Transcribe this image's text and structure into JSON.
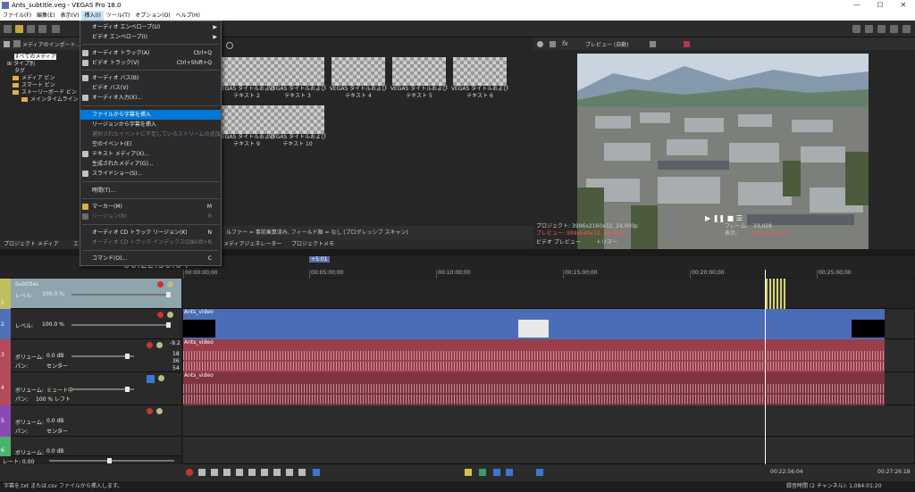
{
  "window": {
    "title": "Ants_subtitle.veg - VEGAS Pro 18.0",
    "minimize": "—",
    "maximize": "☐",
    "close": "✕"
  },
  "menu": [
    "ファイル(F)",
    "編集(E)",
    "表示(V)",
    "挿入(I)",
    "ツール(T)",
    "オプション(O)",
    "ヘルプ(H)"
  ],
  "insert_menu": [
    {
      "label": "オーディオ エンベロープ(U)",
      "shortcut": "",
      "submenu": true
    },
    {
      "label": "ビデオ エンベロープ(I)",
      "shortcut": "",
      "submenu": true
    },
    {
      "label": "オーディオ トラック(A)",
      "shortcut": "Ctrl+Q"
    },
    {
      "label": "ビデオ トラック(V)",
      "shortcut": "Ctrl+Shift+Q"
    },
    {
      "label": "オーディオ バス(B)",
      "shortcut": ""
    },
    {
      "label": "ビデオ バス(V)",
      "shortcut": ""
    },
    {
      "label": "オーディオ入力(X)...",
      "shortcut": ""
    },
    {
      "label": "ファイルから字幕を挿入",
      "shortcut": ""
    },
    {
      "label": "リージョンから字幕を挿入",
      "shortcut": ""
    },
    {
      "label": "選択されたイベントに不足しているストリームの追加",
      "shortcut": ""
    },
    {
      "label": "空のイベント(E)",
      "shortcut": ""
    },
    {
      "label": "テキスト メディア(X)...",
      "shortcut": ""
    },
    {
      "label": "生成されたメディア(G)...",
      "shortcut": ""
    },
    {
      "label": "スライドショー(S)...",
      "shortcut": ""
    },
    {
      "label": "時間(T)...",
      "shortcut": ""
    },
    {
      "label": "マーカー(M)",
      "shortcut": "M"
    },
    {
      "label": "リージョン(R)",
      "shortcut": "R"
    },
    {
      "label": "オーディオ CD トラック リージョン(K)",
      "shortcut": "N"
    },
    {
      "label": "オーディオ CD トラック インデックス(D)",
      "shortcut": "Shift+N"
    },
    {
      "label": "コマンド(O)...",
      "shortcut": "C"
    }
  ],
  "media_panel": {
    "header": "メディアのインポート...",
    "tree": [
      "すべてのメディア",
      "タイプ別",
      "タグ",
      "メディア ビン",
      "スマート ビン",
      "ストーリーボード ビン",
      "メインタイムライン"
    ],
    "thumbs": [
      "VEGAS タイトルおよびテキスト 2",
      "VEGAS タイトルおよびテキスト 3",
      "VEGAS タイトルおよびテキスト 4",
      "VEGAS タイトルおよびテキスト 5",
      "VEGAS タイトルおよびテキスト 6",
      "VEGAS タイトルおよびテキスト 9",
      "VEGAS タイトルおよびテキスト 10"
    ],
    "info": "ルファー = 事前乗算済み, フィールド順 = なし (プログレッシブ スキャン)"
  },
  "lower_tabs": [
    "プロジェクト メディア",
    "エ",
    "メディアジェネレーター",
    "プロジェクトメモ"
  ],
  "preview": {
    "toolbar_label": "プレビュー (自動)",
    "project": "プロジェクト: 3996x2160x32, 24.000p",
    "preview": "プレビュー: 999x540x32, 24.000p",
    "frame_label": "フレーム:",
    "frame_value": "33,028",
    "display_label": "表示:",
    "display_value": "614x332x32",
    "tab_preview": "ビデオ プレビュー",
    "tab_trimmer": "トリマー"
  },
  "timeline": {
    "timecode": "00:22:56:04",
    "marker": "+5:01",
    "ruler": [
      "00:00:00;00",
      "00:05:00;00",
      "00:10:00;00",
      "00:15:00;00",
      "00:20:00;00",
      "00:25:00;00"
    ],
    "tracks": [
      {
        "num": "1",
        "name": "Subtitles",
        "param": "レベル:",
        "value": "100.0 %",
        "color": "#bfbf60"
      },
      {
        "num": "2",
        "name": "",
        "param": "レベル:",
        "value": "100.0 %",
        "color": "#4f6fb6"
      },
      {
        "num": "3",
        "name": "",
        "param": "ボリューム:",
        "value": "0.0 dB",
        "param2": "パン:",
        "value2": "センター",
        "color": "#b44a5a"
      },
      {
        "num": "4",
        "name": "",
        "param": "ボリューム:",
        "value": "ミュート中",
        "param2": "パン:",
        "value2": "100 % レフト",
        "color": "#b44a5a"
      },
      {
        "num": "5",
        "name": "",
        "param": "ボリューム:",
        "value": "0.0 dB",
        "param2": "パン:",
        "value2": "センター",
        "color": "#8a4ab4"
      },
      {
        "num": "6",
        "name": "",
        "param": "ボリューム:",
        "value": "0.0 dB",
        "param2": "",
        "value2": "",
        "color": "#4ab46a"
      }
    ],
    "clips": [
      "Ants_video",
      "Ants_video",
      "Ants_video"
    ],
    "db_scale": [
      "-9.2",
      "18",
      "36",
      "54"
    ],
    "rate_label": "レート: 0.00",
    "pos_time": "00:22:56:04",
    "end_time": "00:27:26:18"
  },
  "status": {
    "left": "字幕を.txt または.csv ファイルから挿入します。",
    "right": "録音時間 (2 チャンネル): 1,084:01:20"
  }
}
